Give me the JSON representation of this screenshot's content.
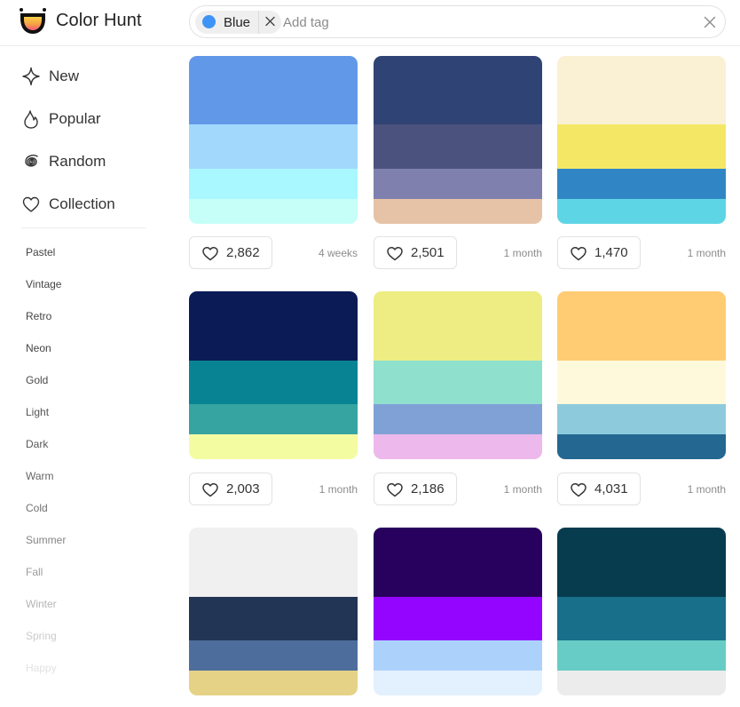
{
  "app": {
    "name": "Color Hunt"
  },
  "search": {
    "active_tag": {
      "label": "Blue",
      "color": "#3d94f6"
    },
    "placeholder": "Add tag",
    "value": ""
  },
  "nav": {
    "items": [
      {
        "label": "New",
        "icon": "sparkle-icon"
      },
      {
        "label": "Popular",
        "icon": "flame-icon"
      },
      {
        "label": "Random",
        "icon": "spiral-icon"
      },
      {
        "label": "Collection",
        "icon": "heart-icon"
      }
    ]
  },
  "tags": {
    "items": [
      {
        "label": "Pastel",
        "color": "#444444"
      },
      {
        "label": "Vintage",
        "color": "#444444"
      },
      {
        "label": "Retro",
        "color": "#444444"
      },
      {
        "label": "Neon",
        "color": "#444444"
      },
      {
        "label": "Gold",
        "color": "#4a4a4a"
      },
      {
        "label": "Light",
        "color": "#555555"
      },
      {
        "label": "Dark",
        "color": "#5a5a5a"
      },
      {
        "label": "Warm",
        "color": "#666666"
      },
      {
        "label": "Cold",
        "color": "#717171"
      },
      {
        "label": "Summer",
        "color": "#858585"
      },
      {
        "label": "Fall",
        "color": "#9c9c9c"
      },
      {
        "label": "Winter",
        "color": "#b4b4b4"
      },
      {
        "label": "Spring",
        "color": "#cbcbcb"
      },
      {
        "label": "Happy",
        "color": "#e2e2e2"
      }
    ]
  },
  "palettes": [
    {
      "colors": [
        "#6298e8",
        "#a2d8fc",
        "#a9f8ff",
        "#c5fff7"
      ],
      "likes": "2,862",
      "age": "4 weeks"
    },
    {
      "colors": [
        "#2f4374",
        "#4b527e",
        "#7f80ad",
        "#e6c3a7"
      ],
      "likes": "2,501",
      "age": "1 month"
    },
    {
      "colors": [
        "#faf1d5",
        "#f4e766",
        "#3086c5",
        "#5ed5e5"
      ],
      "likes": "1,470",
      "age": "1 month"
    },
    {
      "colors": [
        "#0a1b56",
        "#088393",
        "#36a4a0",
        "#f4fca2"
      ],
      "likes": "2,003",
      "age": "1 month"
    },
    {
      "colors": [
        "#eded83",
        "#8fe0cd",
        "#80a1d6",
        "#edb9ec"
      ],
      "likes": "2,186",
      "age": "1 month"
    },
    {
      "colors": [
        "#ffcc74",
        "#fff9db",
        "#8dcbdc",
        "#246791"
      ],
      "likes": "4,031",
      "age": "1 month"
    },
    {
      "colors": [
        "#f0f0f0",
        "#233554",
        "#4d6e9d",
        "#e6d286"
      ],
      "likes": "",
      "age": ""
    },
    {
      "colors": [
        "#28005d",
        "#9305ff",
        "#acd2fc",
        "#e3f0fd"
      ],
      "likes": "",
      "age": ""
    },
    {
      "colors": [
        "#073c4f",
        "#176f89",
        "#67ccc5",
        "#ececec"
      ],
      "likes": "",
      "age": ""
    }
  ]
}
